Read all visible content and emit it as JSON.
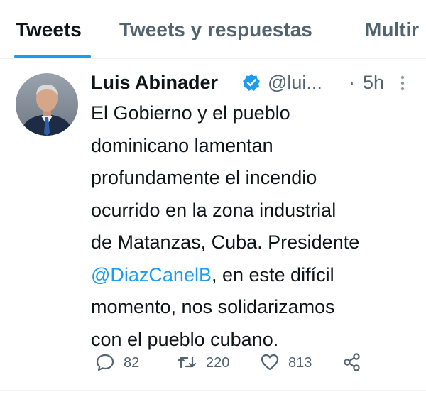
{
  "tabs": [
    {
      "label": "Tweets",
      "active": true
    },
    {
      "label": "Tweets y respuestas",
      "active": false
    },
    {
      "label": "Multir",
      "active": false
    }
  ],
  "tweet": {
    "author_name": "Luis Abinader",
    "verified": true,
    "handle": "@lui...",
    "separator": "·",
    "time": "5h",
    "text_lines": [
      "El Gobierno y el pueblo",
      "dominicano lamentan",
      "profundamente el incendio",
      "ocurrido en la zona industrial",
      "de Matanzas, Cuba. Presidente"
    ],
    "mention": "@DiazCanelB",
    "after_mention": ", en este difícil",
    "text_lines_end": [
      "momento, nos solidarizamos",
      "con el pueblo cubano."
    ],
    "reply_count": "82",
    "retweet_count": "220",
    "like_count": "813"
  },
  "icons": {
    "verified": "verified-badge-icon",
    "more": "more-vertical-icon",
    "reply": "reply-icon",
    "retweet": "retweet-icon",
    "like": "heart-icon",
    "share": "share-icon"
  },
  "colors": {
    "accent": "#1d9bf0",
    "text_primary": "#0f1419",
    "text_secondary": "#536471",
    "border": "#eff3f4"
  }
}
